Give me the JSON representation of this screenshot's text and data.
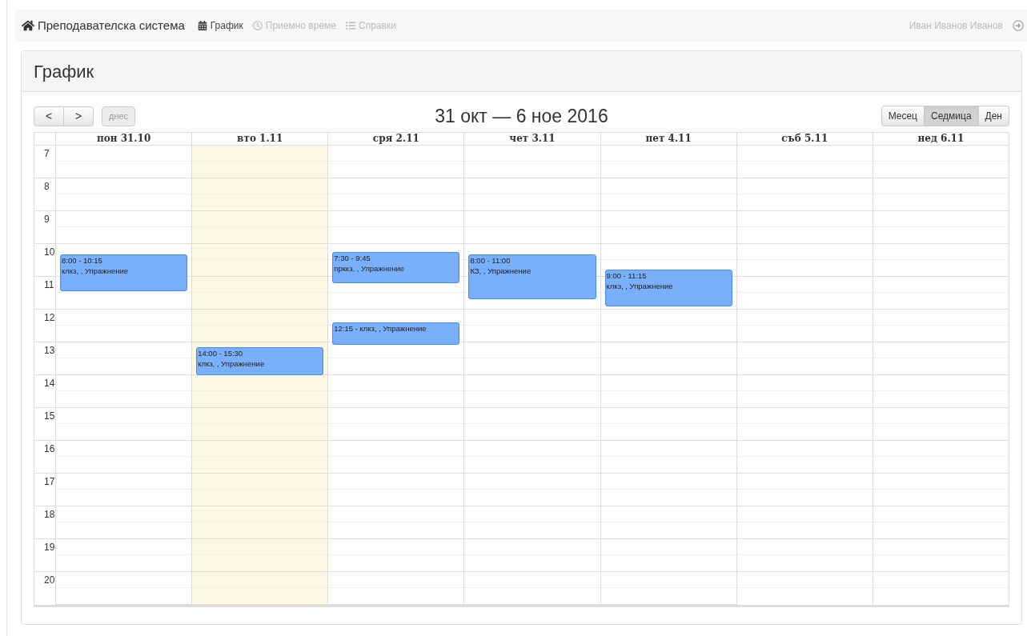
{
  "navbar": {
    "brand": "Преподавателска система",
    "items": [
      {
        "label": "График",
        "kind": "calendar",
        "selected": true
      },
      {
        "label": "Приемно време",
        "kind": "clock",
        "selected": false
      },
      {
        "label": "Справки",
        "kind": "list",
        "selected": false
      }
    ],
    "user": "Иван Иванов Иванов"
  },
  "panel": {
    "title": "График"
  },
  "toolbar": {
    "prev": "<",
    "next": ">",
    "today": {
      "label": "днес",
      "disabled": true
    },
    "range": "31 окт — 6 ное 2016",
    "views": [
      {
        "label": "Месец",
        "selected": false
      },
      {
        "label": "Седмица",
        "selected": true
      },
      {
        "label": "Ден",
        "selected": false
      }
    ]
  },
  "calendar": {
    "hours": [
      "7",
      "8",
      "9",
      "10",
      "11",
      "12",
      "13",
      "14",
      "15",
      "16",
      "17",
      "18",
      "19",
      "20"
    ],
    "days": [
      {
        "label": "пон 31.10",
        "today": false,
        "events": [
          {
            "lines": [
              "8:00 - 10:15",
              "клкз, , Упражнение"
            ]
          }
        ]
      },
      {
        "label": "вто 1.11",
        "today": true,
        "events": [
          {
            "lines": [
              "14:00 - 15:30",
              "клкз, , Упражнение"
            ]
          }
        ]
      },
      {
        "label": "сря 2.11",
        "today": false,
        "events": [
          {
            "lines": [
              "7:30 - 9:45",
              "прккз, , Упражнение"
            ]
          },
          {
            "lines": [
              "12:15 - клкз, , Упражнение"
            ]
          }
        ]
      },
      {
        "label": "чет 3.11",
        "today": false,
        "events": [
          {
            "lines": [
              "8:00 - 11:00",
              "КЗ, , Упражнение"
            ]
          }
        ]
      },
      {
        "label": "пет 4.11",
        "today": false,
        "events": [
          {
            "lines": [
              "9:00 - 11:15",
              "клкз, , Упражнение"
            ]
          }
        ]
      },
      {
        "label": "съб 5.11",
        "today": false
      },
      {
        "label": "нед 6.11",
        "today": false
      }
    ]
  }
}
